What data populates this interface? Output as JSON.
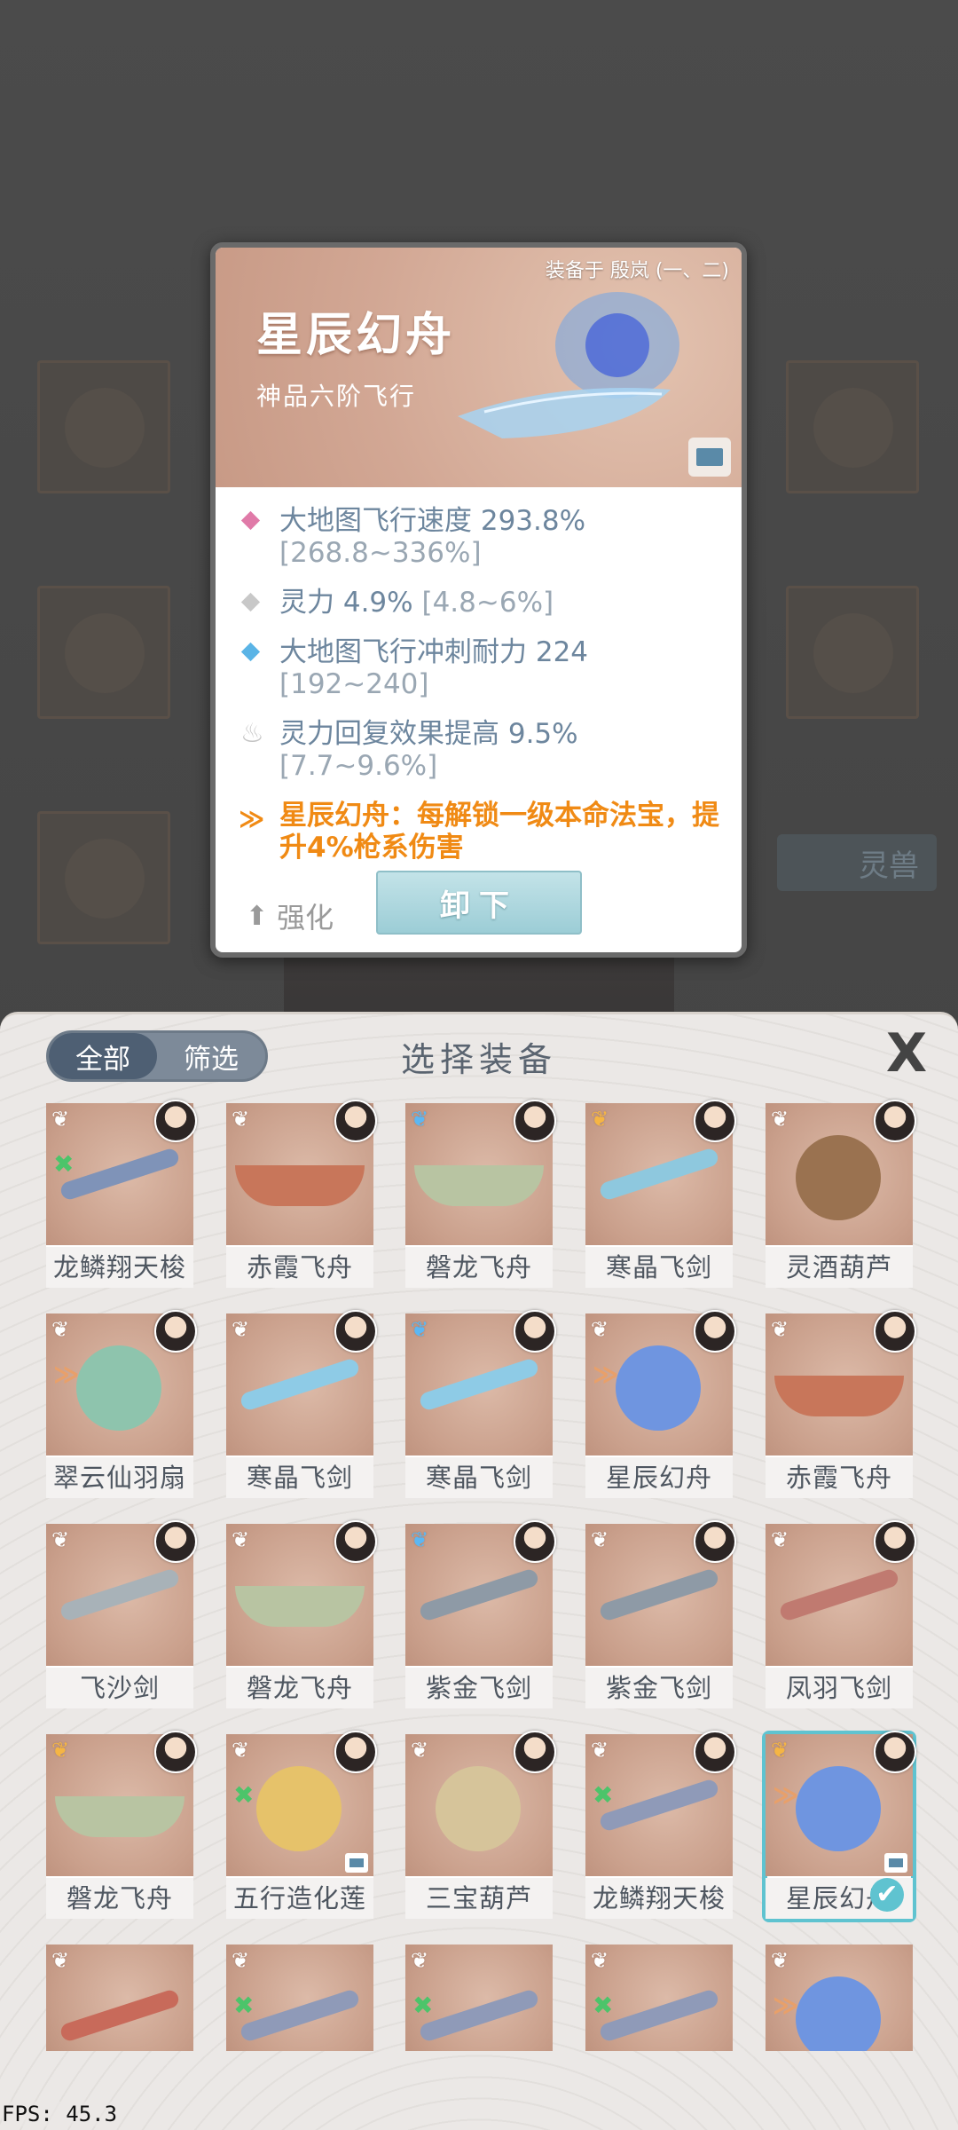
{
  "background": {
    "tab_label": "灵兽"
  },
  "detail": {
    "equipped_on": "装备于 殷岚 (一、二)",
    "name": "星辰幻舟",
    "grade": "神品六阶飞行",
    "stats": [
      {
        "text": "大地图飞行速度 293.8%",
        "range": "[268.8~336%]",
        "color": "#e07aa8"
      },
      {
        "text": "灵力 4.9%",
        "range": "[4.8~6%]",
        "color": "#c8c8c8"
      },
      {
        "text": "大地图飞行冲刺耐力 224",
        "range": "[192~240]",
        "color": "#5ab4e6"
      },
      {
        "text": "灵力回复效果提高 9.5%",
        "range": "[7.7~9.6%]",
        "color": "#c4c4c4"
      }
    ],
    "skill": "星辰幻舟：每解锁一级本命法宝，提升4%枪系伤害",
    "enhance_label": "强化",
    "unload_label": "卸下"
  },
  "panel": {
    "filter_all": "全部",
    "filter_screen": "筛选",
    "title": "选择装备",
    "close_glyph": "X",
    "items": [
      {
        "name": "龙鳞翔天梭",
        "wing": "white",
        "mark": "green"
      },
      {
        "name": "赤霞飞舟",
        "wing": "white",
        "mark": ""
      },
      {
        "name": "磐龙飞舟",
        "wing": "blue",
        "mark": ""
      },
      {
        "name": "寒晶飞剑",
        "wing": "gold",
        "mark": ""
      },
      {
        "name": "灵酒葫芦",
        "wing": "white",
        "mark": ""
      },
      {
        "name": "翠云仙羽扇",
        "wing": "white",
        "mark": "orange"
      },
      {
        "name": "寒晶飞剑",
        "wing": "white",
        "mark": ""
      },
      {
        "name": "寒晶飞剑",
        "wing": "blue",
        "mark": ""
      },
      {
        "name": "星辰幻舟",
        "wing": "white",
        "mark": "orange"
      },
      {
        "name": "赤霞飞舟",
        "wing": "white",
        "mark": ""
      },
      {
        "name": "飞沙剑",
        "wing": "white",
        "mark": ""
      },
      {
        "name": "磐龙飞舟",
        "wing": "white",
        "mark": ""
      },
      {
        "name": "紫金飞剑",
        "wing": "blue",
        "mark": ""
      },
      {
        "name": "紫金飞剑",
        "wing": "white",
        "mark": ""
      },
      {
        "name": "凤羽飞剑",
        "wing": "white",
        "mark": ""
      },
      {
        "name": "磐龙飞舟",
        "wing": "gold",
        "mark": ""
      },
      {
        "name": "五行造化莲",
        "wing": "white",
        "mark": "green"
      },
      {
        "name": "三宝葫芦",
        "wing": "white",
        "mark": ""
      },
      {
        "name": "龙鳞翔天梭",
        "wing": "white",
        "mark": "green"
      },
      {
        "name": "星辰幻舟",
        "wing": "gold",
        "mark": "orange",
        "selected": true
      },
      {
        "name": "",
        "wing": "white",
        "mark": ""
      },
      {
        "name": "",
        "wing": "white",
        "mark": "green"
      },
      {
        "name": "",
        "wing": "white",
        "mark": "green"
      },
      {
        "name": "",
        "wing": "white",
        "mark": "green"
      },
      {
        "name": "",
        "wing": "white",
        "mark": "orange"
      }
    ]
  },
  "fps": "FPS: 45.3"
}
